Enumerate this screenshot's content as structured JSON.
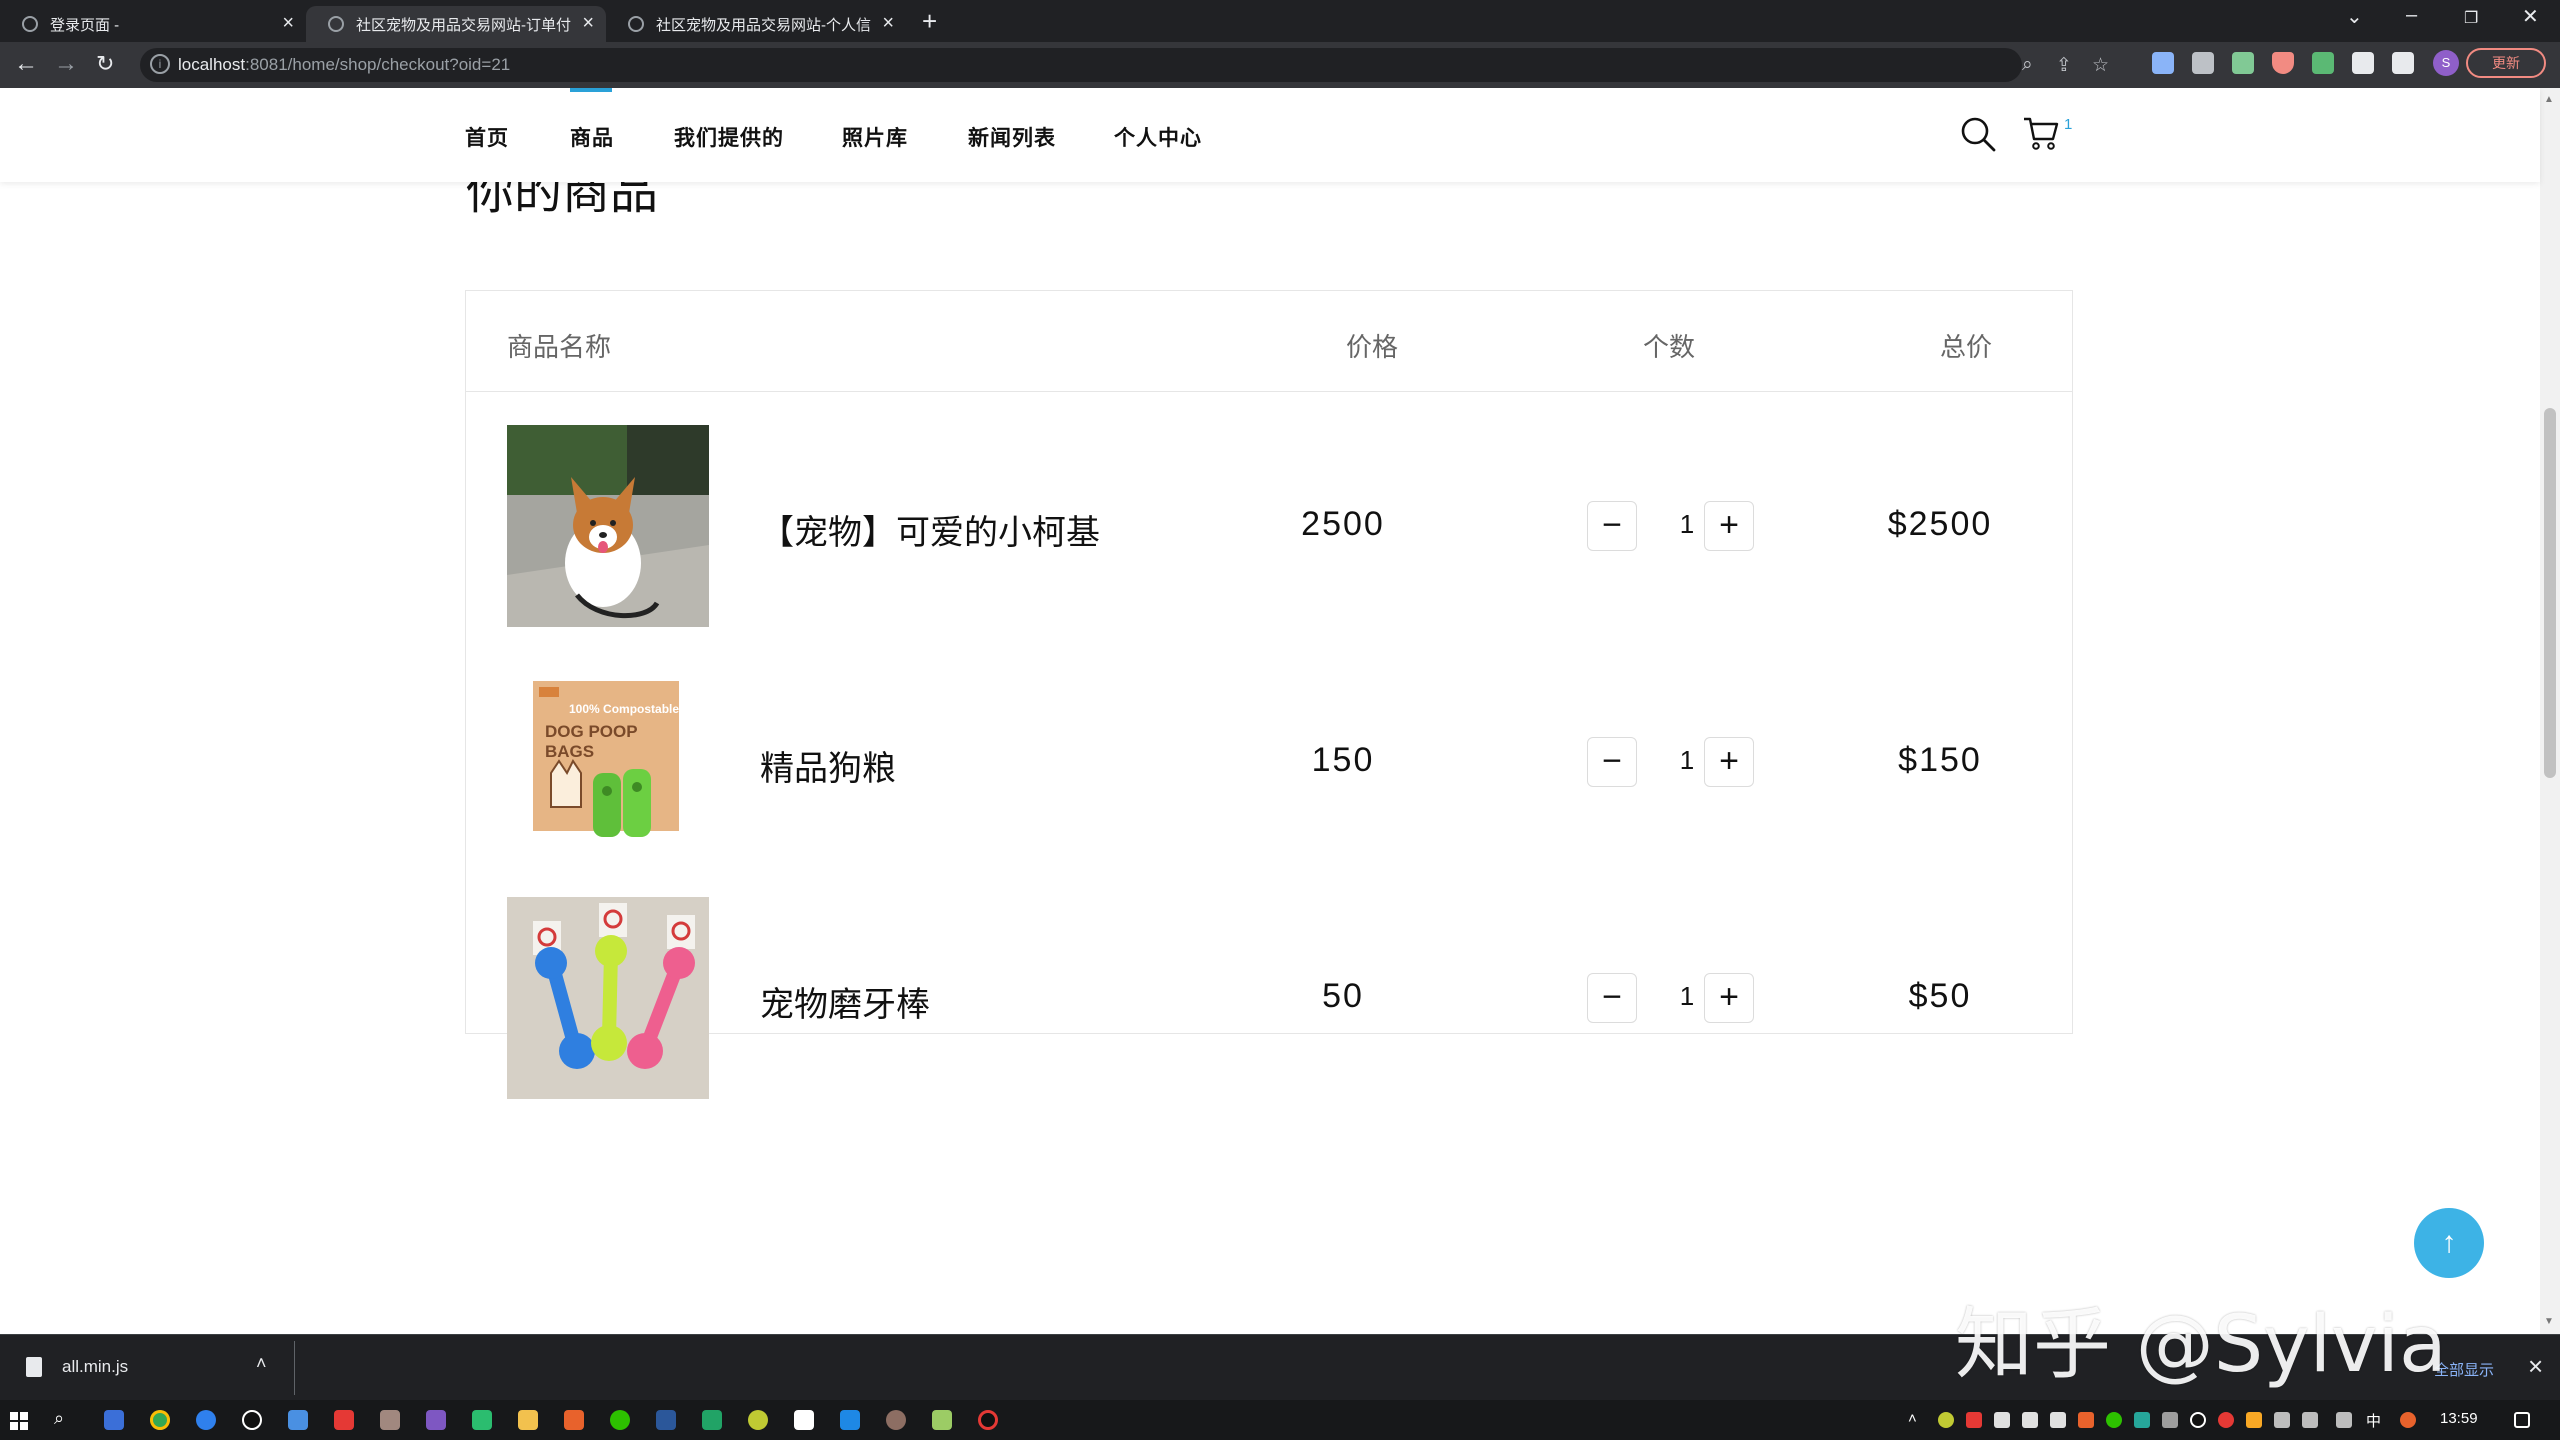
{
  "browser": {
    "tabs": [
      {
        "title": "登录页面 -"
      },
      {
        "title": "社区宠物及用品交易网站-订单付"
      },
      {
        "title": "社区宠物及用品交易网站-个人信"
      }
    ],
    "url_host": "localhost",
    "url_rest": ":8081/home/shop/checkout?oid=21",
    "profile_initial": "S",
    "update_label": "更新"
  },
  "site": {
    "nav": [
      "首页",
      "商品",
      "我们提供的",
      "照片库",
      "新闻列表",
      "个人中心"
    ],
    "active_nav": "商品",
    "cart_count": "1",
    "section_title": "你的商品",
    "table_headers": {
      "name": "商品名称",
      "price": "价格",
      "qty": "个数",
      "total": "总价"
    },
    "items": [
      {
        "name": "【宠物】可爱的小柯基",
        "price": "2500",
        "qty": "1",
        "total": "$2500",
        "image": "corgi-photo"
      },
      {
        "name": "精品狗粮",
        "price": "150",
        "qty": "1",
        "total": "$150",
        "image": "dog-poop-bags-box"
      },
      {
        "name": "宠物磨牙棒",
        "price": "50",
        "qty": "1",
        "total": "$50",
        "image": "chew-toys-photo"
      }
    ],
    "qty_minus_label": "−",
    "qty_plus_label": "+",
    "scroll_top_icon": "↑",
    "watermark": "知乎 @Sylvia"
  },
  "downloads": {
    "file_name": "all.min.js",
    "show_all_label": "全部显示"
  },
  "taskbar": {
    "ime": "中",
    "clock": "13:59"
  },
  "colors": {
    "accent": "#2aa1d8",
    "scroll_top_button": "#3db3e6"
  }
}
